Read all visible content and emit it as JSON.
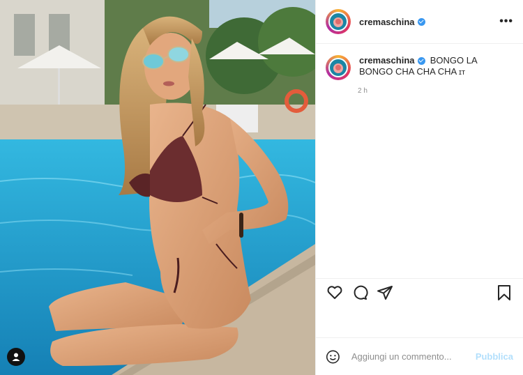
{
  "post": {
    "username": "cremaschina",
    "caption": "BONGO LA BONGO CHA CHA CHA 🇮🇹",
    "caption_flag": "ɪᴛ",
    "timestamp": "2 h",
    "more_icon": "•••"
  },
  "comment": {
    "placeholder": "Aggiungi un commento...",
    "publish_label": "Pubblica"
  },
  "colors": {
    "accent": "#3897f0",
    "publish_disabled": "#b2dffc",
    "pool": "#2a9fc9"
  },
  "icons": {
    "like": "heart-icon",
    "comment": "comment-icon",
    "share": "share-icon",
    "save": "bookmark-icon",
    "emoji": "emoji-icon",
    "tags": "user-tag-icon",
    "more": "more-options-icon",
    "verified": "verified-badge-icon"
  }
}
